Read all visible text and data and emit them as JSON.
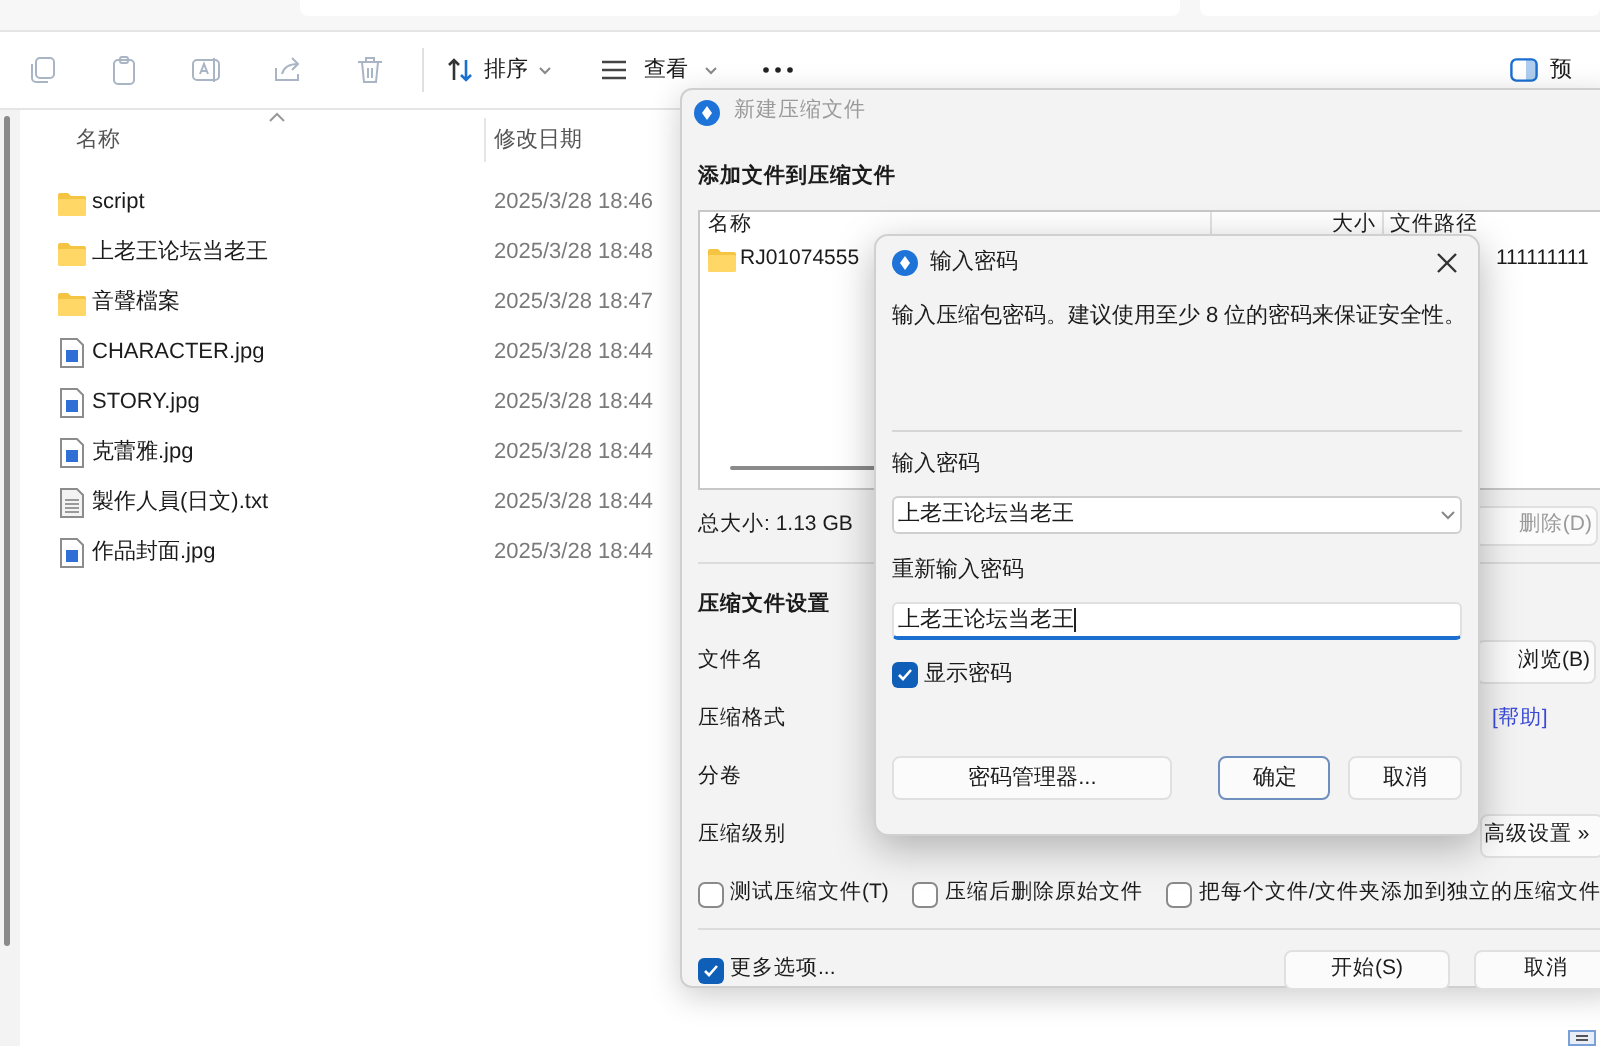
{
  "explorer": {
    "toolbar": {
      "sort_label": "排序",
      "view_label": "查看",
      "preview_label": "预"
    },
    "columns": [
      "名称",
      "修改日期"
    ],
    "files": [
      {
        "kind": "folder",
        "name": "script",
        "modified": "2025/3/28 18:46"
      },
      {
        "kind": "folder",
        "name": "上老王论坛当老王",
        "modified": "2025/3/28 18:48"
      },
      {
        "kind": "folder",
        "name": "音聲檔案",
        "modified": "2025/3/28 18:47"
      },
      {
        "kind": "image",
        "name": "CHARACTER.jpg",
        "modified": "2025/3/28 18:44"
      },
      {
        "kind": "image",
        "name": "STORY.jpg",
        "modified": "2025/3/28 18:44"
      },
      {
        "kind": "image",
        "name": "克蕾雅.jpg",
        "modified": "2025/3/28 18:44"
      },
      {
        "kind": "text",
        "name": "製作人員(日文).txt",
        "modified": "2025/3/28 18:44"
      },
      {
        "kind": "image",
        "name": "作品封面.jpg",
        "modified": "2025/3/28 18:44"
      }
    ]
  },
  "archive_dialog": {
    "title": "新建压缩文件",
    "add_heading": "添加文件到压缩文件",
    "list_columns": [
      "名称",
      "大小",
      "文件路径"
    ],
    "list_row": {
      "name": "RJ01074555",
      "path": "111111111"
    },
    "total_size": "总大小: 1.13 GB",
    "delete_button": "删除(D)",
    "settings_heading": "压缩文件设置",
    "setting_labels": [
      "文件名",
      "压缩格式",
      "分卷",
      "压缩级别"
    ],
    "browse_button": "浏览(B)",
    "help_link": "[帮助]",
    "advanced_button": "高级设置 »",
    "options": [
      {
        "label": "测试压缩文件(T)",
        "checked": false
      },
      {
        "label": "压缩后删除原始文件",
        "checked": false
      },
      {
        "label": "把每个文件/文件夹添加到独立的压缩文件",
        "checked": false
      }
    ],
    "more_options": {
      "label": "更多选项...",
      "checked": true
    },
    "buttons": [
      "开始(S)",
      "取消"
    ]
  },
  "password_dialog": {
    "title": "输入密码",
    "description": "输入压缩包密码。建议使用至少 8 位的密码来保证安全性。",
    "password_label": "输入密码",
    "password_value": "上老王论坛当老王",
    "confirm_label": "重新输入密码",
    "confirm_value": "上老王论坛当老王",
    "show_password": {
      "label": "显示密码",
      "checked": true
    },
    "manager_button": "密码管理器...",
    "ok_button": "确定",
    "cancel_button": "取消"
  }
}
